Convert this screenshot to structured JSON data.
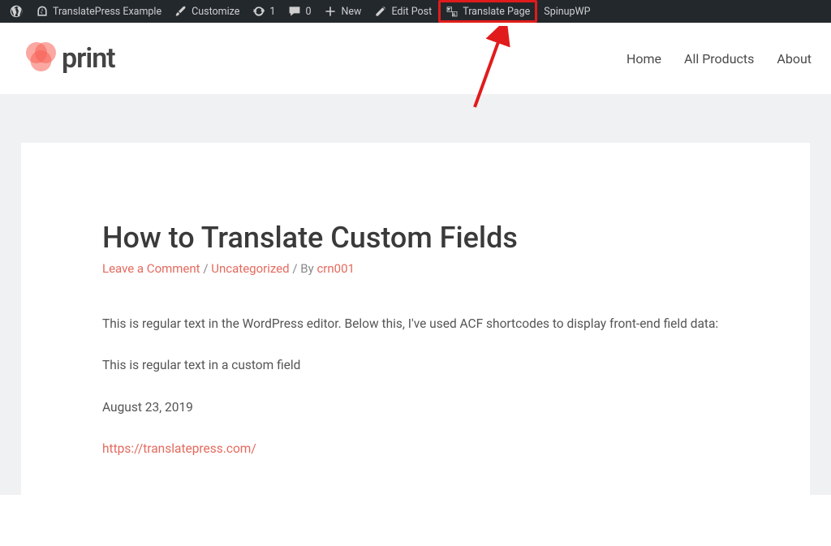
{
  "admin_bar": {
    "site_name": "TranslatePress Example",
    "customize": "Customize",
    "updates_count": "1",
    "comments_count": "0",
    "new_label": "New",
    "edit_post": "Edit Post",
    "translate_page": "Translate Page",
    "spinupwp": "SpinupWP"
  },
  "header": {
    "logo_text": "print",
    "nav": {
      "home": "Home",
      "all_products": "All Products",
      "about": "About"
    }
  },
  "post": {
    "title": "How to Translate Custom Fields",
    "meta": {
      "leave_comment": "Leave a Comment",
      "sep1": "/",
      "category": "Uncategorized",
      "sep2": "/",
      "by_label": "By",
      "author": "crn001"
    },
    "content": {
      "p1": "This is regular text in the WordPress editor. Below this, I've used ACF shortcodes to display front-end field data:",
      "p2": "This is regular text in a custom field",
      "p3": "August 23, 2019",
      "link": "https://translatepress.com/"
    }
  },
  "annotation": {
    "highlight_color": "#e11b1b",
    "brand_accent": "#f76055"
  }
}
